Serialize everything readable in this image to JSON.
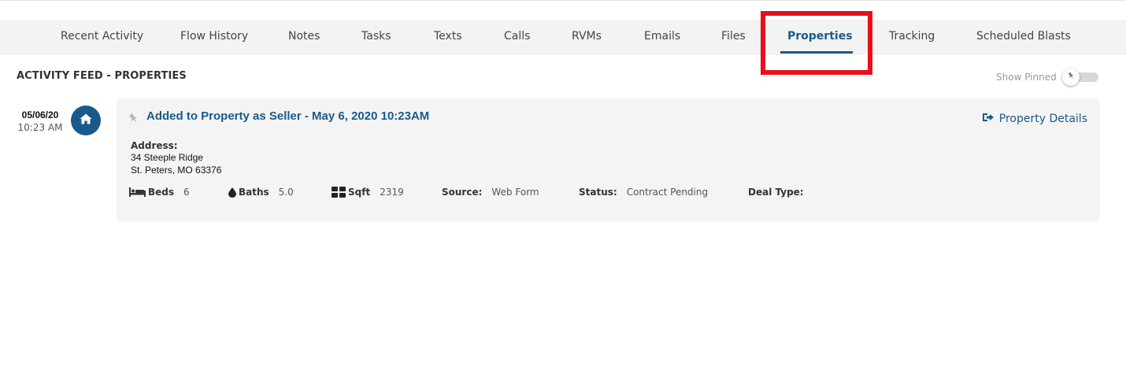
{
  "tabs": [
    {
      "label": "Recent Activity"
    },
    {
      "label": "Flow History"
    },
    {
      "label": "Notes"
    },
    {
      "label": "Tasks"
    },
    {
      "label": "Texts"
    },
    {
      "label": "Calls"
    },
    {
      "label": "RVMs"
    },
    {
      "label": "Emails"
    },
    {
      "label": "Files"
    },
    {
      "label": "Properties",
      "active": true
    },
    {
      "label": "Tracking"
    },
    {
      "label": "Scheduled Blasts"
    }
  ],
  "section": {
    "title": "ACTIVITY FEED - PROPERTIES",
    "show_pinned_label": "Show Pinned",
    "show_pinned_on": false
  },
  "entry": {
    "date": "05/06/20",
    "time": "10:23 AM",
    "icon": "home-icon",
    "title": "Added to Property as Seller - May 6, 2020 10:23AM",
    "details_link": "Property Details",
    "address_label": "Address:",
    "address_line1": "34 Steeple Ridge",
    "address_line2": "St. Peters, MO 63376",
    "beds_label": "Beds",
    "beds_value": "6",
    "baths_label": "Baths",
    "baths_value": "5.0",
    "sqft_label": "Sqft",
    "sqft_value": "2319",
    "source_label": "Source:",
    "source_value": "Web Form",
    "status_label": "Status:",
    "status_value": "Contract Pending",
    "deal_type_label": "Deal Type:",
    "deal_type_value": ""
  },
  "colors": {
    "accent": "#1a5a8a",
    "highlight": "#e8101f",
    "card_bg": "#f4f4f4",
    "tabbar_bg": "#f3f3f3"
  }
}
